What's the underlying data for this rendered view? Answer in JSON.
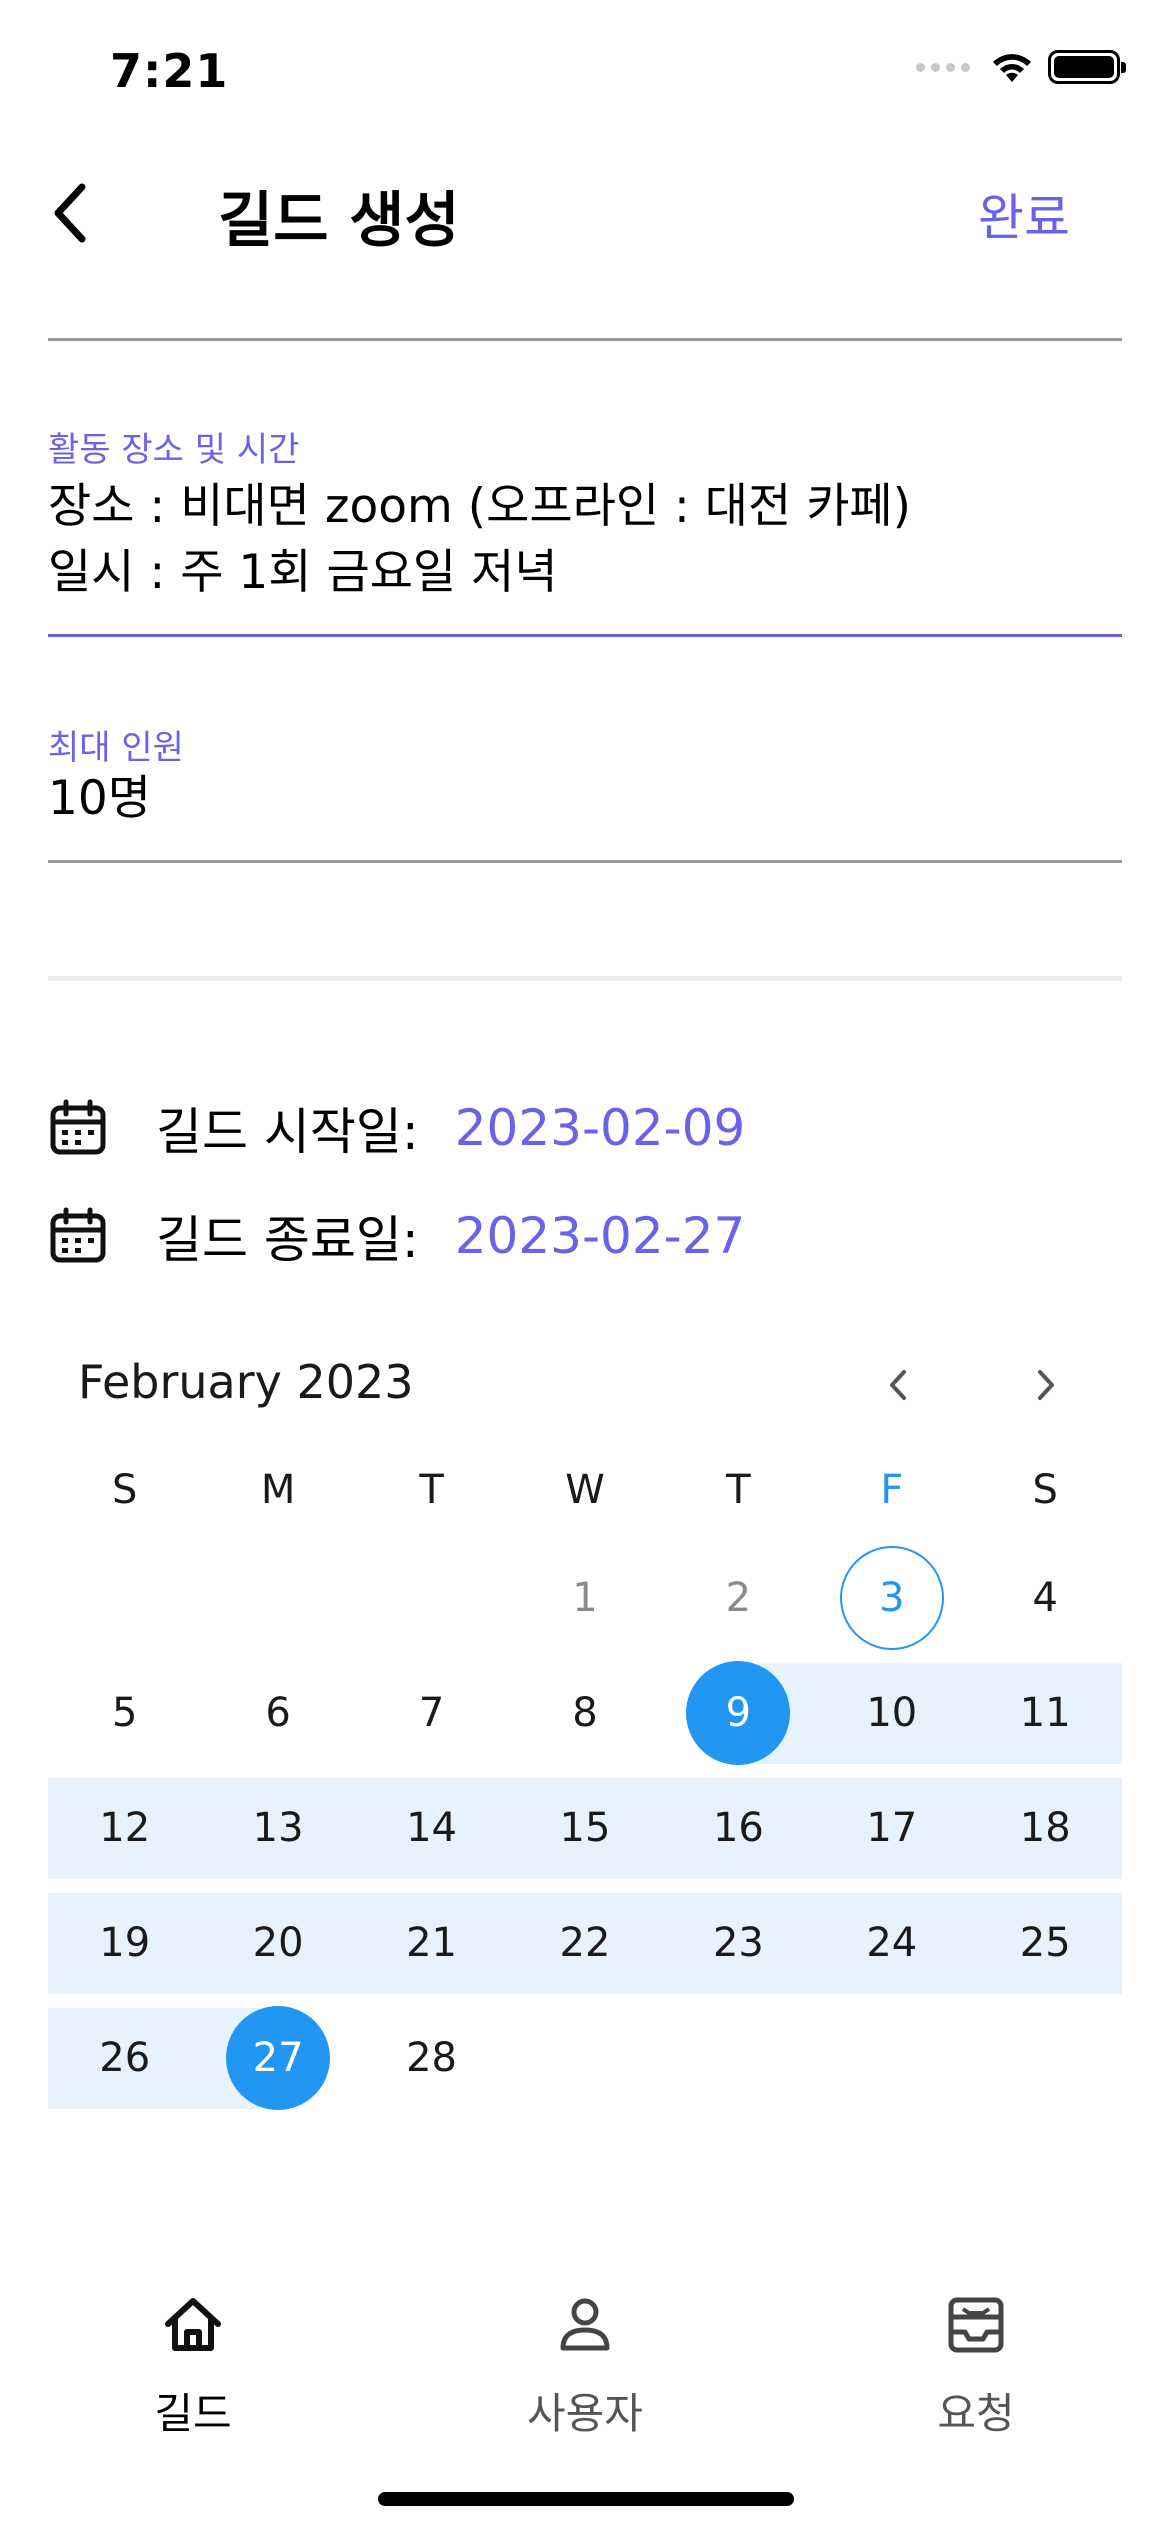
{
  "status_bar": {
    "time": "7:21"
  },
  "header": {
    "title": "길드 생성",
    "done_label": "완료"
  },
  "fields": {
    "activity": {
      "label": "활동 장소 및 시간",
      "line1": "장소 : 비대면 zoom (오프라인 : 대전 카페)",
      "line2": "일시 : 주 1회 금요일 저녁"
    },
    "max_members": {
      "label": "최대 인원",
      "value": "10명"
    }
  },
  "dates": {
    "start_label": "길드 시작일:",
    "start_value": "2023-02-09",
    "end_label": "길드 종료일:",
    "end_value": "2023-02-27"
  },
  "calendar": {
    "month_label": "February 2023",
    "weekdays": [
      "S",
      "M",
      "T",
      "W",
      "T",
      "F",
      "S"
    ],
    "today": 3,
    "range_start": 9,
    "range_end": 27,
    "weeks": [
      [
        "",
        "",
        "",
        "1",
        "2",
        "3",
        "4"
      ],
      [
        "5",
        "6",
        "7",
        "8",
        "9",
        "10",
        "11"
      ],
      [
        "12",
        "13",
        "14",
        "15",
        "16",
        "17",
        "18"
      ],
      [
        "19",
        "20",
        "21",
        "22",
        "23",
        "24",
        "25"
      ],
      [
        "26",
        "27",
        "28",
        "",
        "",
        "",
        ""
      ]
    ],
    "colors": {
      "accent": "#2196f3",
      "range_band": "#e6f2fd"
    }
  },
  "tabs": [
    {
      "label": "길드",
      "icon": "home-icon",
      "active": true
    },
    {
      "label": "사용자",
      "icon": "user-icon",
      "active": false
    },
    {
      "label": "요청",
      "icon": "inbox-icon",
      "active": false
    }
  ],
  "colors": {
    "primary": "#6a62e8",
    "accent": "#2196f3"
  }
}
